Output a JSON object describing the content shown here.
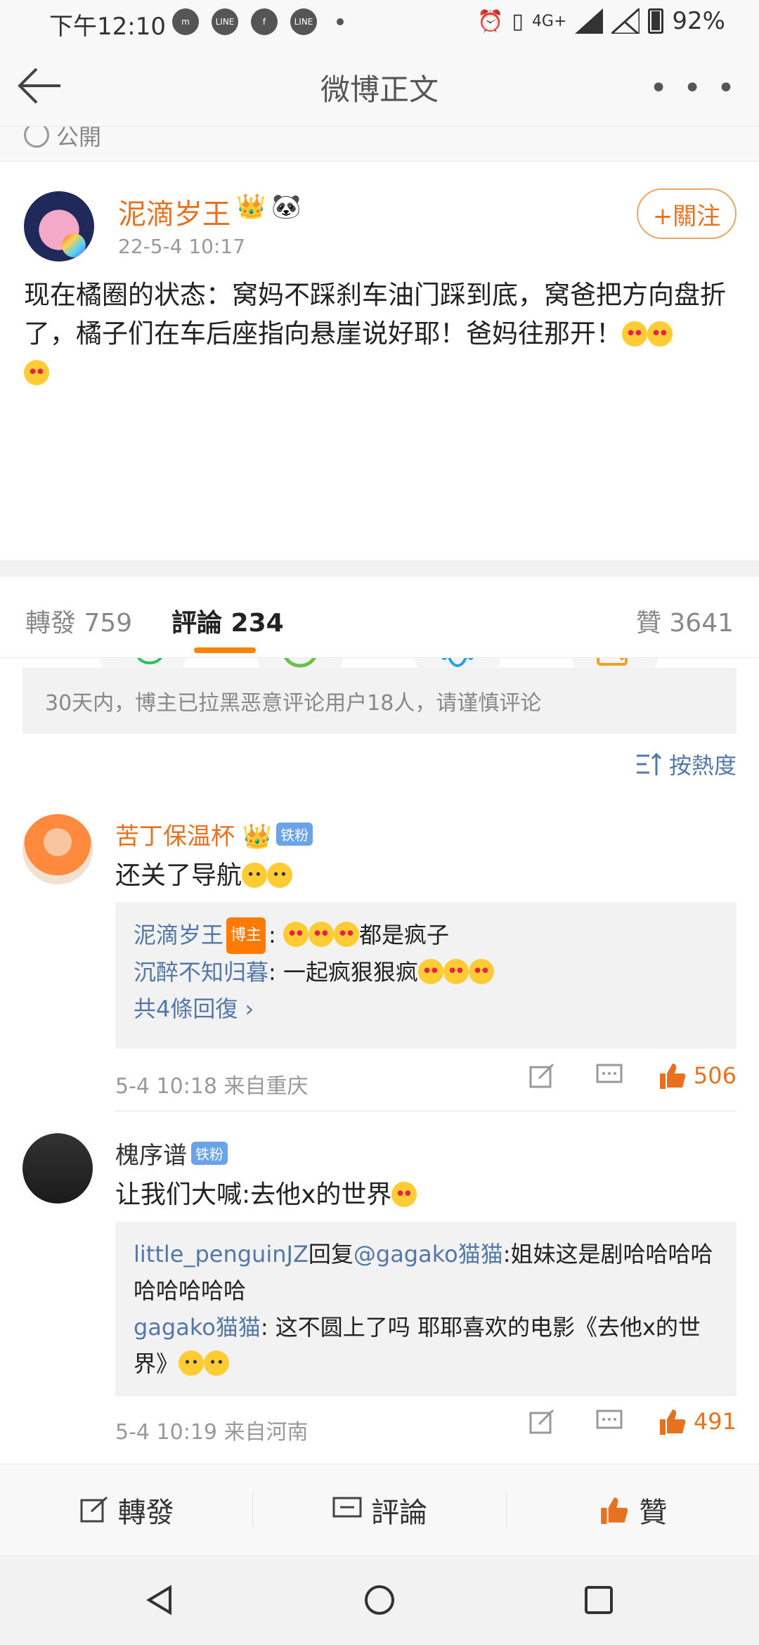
{
  "status_bar": {
    "time": "下午12:10",
    "network": "4G+",
    "battery": "92%"
  },
  "nav": {
    "title": "微博正文",
    "more": "• • •"
  },
  "visibility": "公開",
  "post": {
    "author": "泥滴岁王",
    "time": "22-5-4 10:17",
    "follow_label": "+關注",
    "text_part1": "现在橘圈的状态：窝妈不踩刹车油门踩到底，窝爸把方向盘折了，橘子们在车后座指向悬崖说好耶！爸妈往那开！",
    "share_icons": [
      "wechat-icon",
      "moments-icon",
      "qq-icon",
      "save-image-icon"
    ]
  },
  "tabs": {
    "reposts": "轉發 759",
    "comments": "評論 234",
    "likes": "贊 3641"
  },
  "notice": "30天内，博主已拉黑恶意评论用户18人，请谨慎评论",
  "sort_label": "按熱度",
  "comments": [
    {
      "name": "苦丁保温杯",
      "badge": "铁粉",
      "text": "还关了导航",
      "replies": [
        {
          "who": "泥滴岁王",
          "host_badge": "博主",
          "text": "都是疯子"
        },
        {
          "who": "沉醉不知归暮",
          "text": ": 一起疯狠狠疯"
        }
      ],
      "more_replies": "共4條回復 ›",
      "meta": "5-4 10:18  来自重庆",
      "likes": "506"
    },
    {
      "name": "槐序谱",
      "badge": "铁粉",
      "text": "让我们大喊:去他x的世界",
      "replies": [
        {
          "who": "little_penguinJZ",
          "mid": "回复",
          "who2": "@gagako猫猫",
          "text": ":姐妹这是剧哈哈哈哈哈哈哈哈哈"
        },
        {
          "who": "gagako猫猫",
          "text": ": 这不圆上了吗 耶耶喜欢的电影《去他x的世界》"
        }
      ],
      "meta": "5-4 10:19  来自河南",
      "likes": "491"
    }
  ],
  "bottom_bar": {
    "repost": "轉發",
    "comment": "評論",
    "like": "贊"
  },
  "colors": {
    "accent": "#ff8200",
    "name_orange": "#e8711f",
    "link_blue": "#5378a8"
  }
}
